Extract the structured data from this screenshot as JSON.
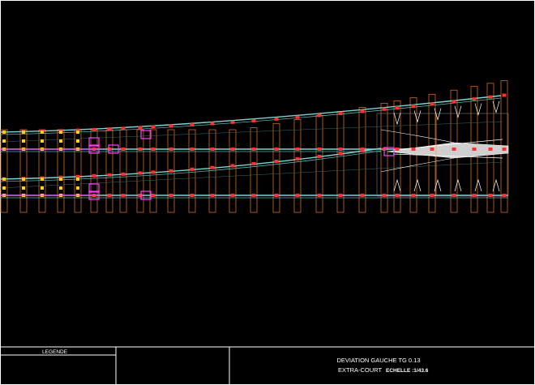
{
  "title_block": {
    "legend_label": "LEGENDE",
    "title_line1": "DEVIATION GAUCHE TG 0.13",
    "title_line2": "EXTRA-COURT",
    "scale_label": "ECHELLE :1/43.6"
  },
  "colors": {
    "background": "#000000",
    "frame": "#ffffff",
    "sleeper": "#d2691e",
    "rail": "#7fd3d3",
    "clip": "#ff3030",
    "joint": "#ff40ff",
    "tie_marker": "#ffd400",
    "frog": "#ffffff"
  }
}
